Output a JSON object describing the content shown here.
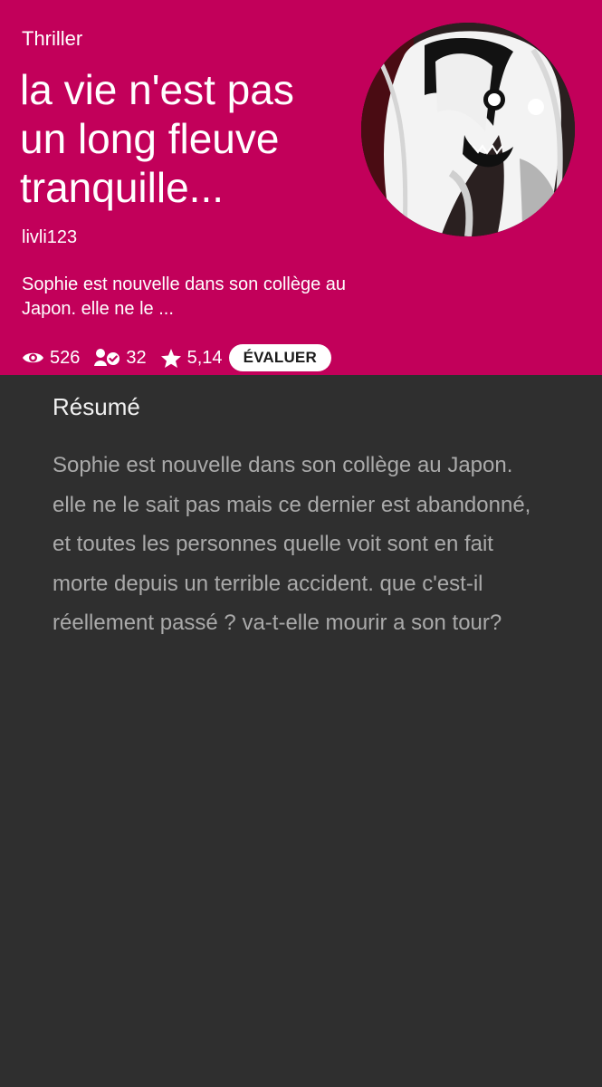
{
  "story": {
    "genre": "Thriller",
    "title": "la vie n'est pas un long fleuve tranquille...",
    "author": "livli123",
    "short_summary": "Sophie est nouvelle dans son collège au Japon. elle ne le ...",
    "cover_icon": "cover-image"
  },
  "stats": {
    "views": "526",
    "followers": "32",
    "rating": "5,14",
    "rate_label": "ÉVALUER"
  },
  "summary_section": {
    "heading": "Résumé",
    "text": "Sophie est nouvelle dans son collège au Japon. elle ne le sait pas mais ce dernier est abandonné, et toutes les personnes quelle voit sont en fait morte depuis un terrible accident. que c'est-il réellement passé ? va-t-elle mourir a son tour?"
  },
  "colors": {
    "header_background": "#c2005a",
    "page_background": "#2f2f2f",
    "summary_text": "#aaaaaa"
  },
  "icons": {
    "views": "eye-icon",
    "followers": "user-check-icon",
    "rating": "star-icon"
  }
}
